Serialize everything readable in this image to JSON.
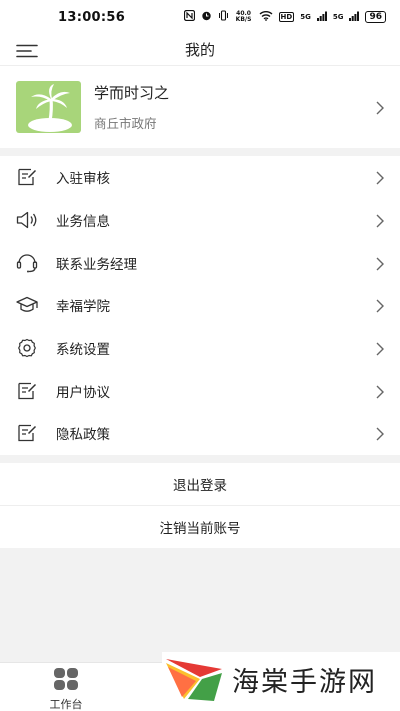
{
  "status_bar": {
    "time": "13:00:56",
    "net_speed": "40.0 KB/S",
    "hd": "HD",
    "signal1": "5G",
    "signal2": "5G",
    "battery": "96"
  },
  "nav": {
    "title": "我的"
  },
  "profile": {
    "name": "学而时习之",
    "org": "商丘市政府"
  },
  "menu": {
    "items": [
      {
        "label": "入驻审核",
        "icon": "edit-doc-icon"
      },
      {
        "label": "业务信息",
        "icon": "speaker-icon"
      },
      {
        "label": "联系业务经理",
        "icon": "headset-icon"
      },
      {
        "label": "幸福学院",
        "icon": "graduation-cap-icon"
      },
      {
        "label": "系统设置",
        "icon": "gear-icon"
      },
      {
        "label": "用户协议",
        "icon": "edit-doc-icon"
      },
      {
        "label": "隐私政策",
        "icon": "edit-doc-icon"
      }
    ]
  },
  "actions": {
    "logout": "退出登录",
    "deregister": "注销当前账号"
  },
  "tabbar": {
    "workbench": "工作台"
  },
  "watermark": {
    "text": "海棠手游网"
  }
}
